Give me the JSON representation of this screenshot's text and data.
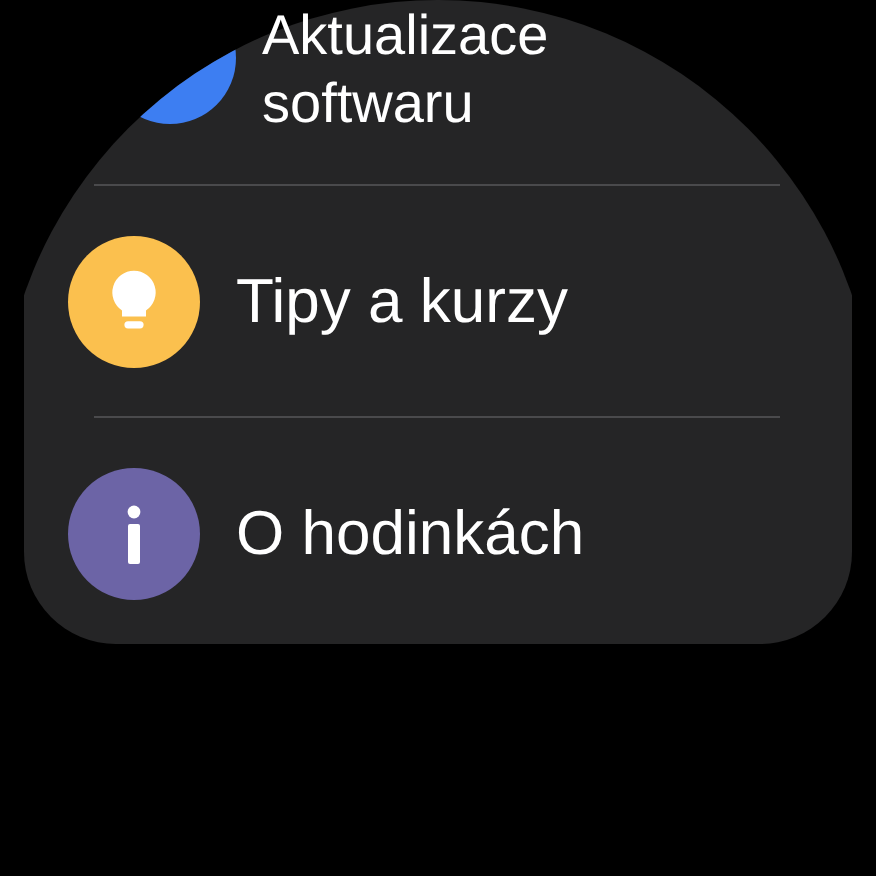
{
  "items": [
    {
      "label": "Aktualizace softwaru",
      "color": "#3d7ef2",
      "kind": "update"
    },
    {
      "label": "Tipy a kurzy",
      "color": "#fbc04e",
      "kind": "tips"
    },
    {
      "label": "O hodinkách",
      "color": "#6c64a6",
      "kind": "about"
    }
  ]
}
